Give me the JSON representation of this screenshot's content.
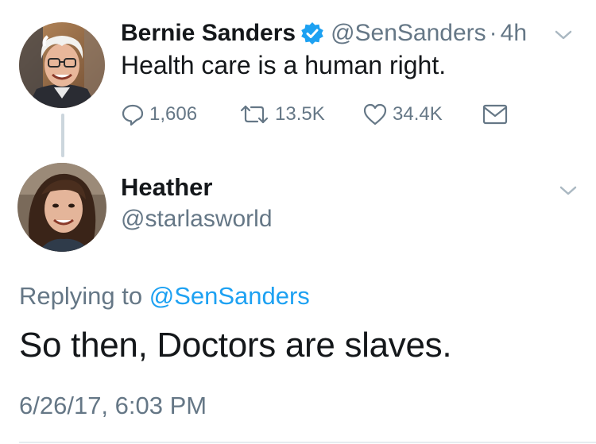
{
  "tweet": {
    "author_name": "Bernie Sanders",
    "author_handle": "@SenSanders",
    "separator": "·",
    "time_ago": "4h",
    "text": "Health care is a human right.",
    "stats": {
      "replies": "1,606",
      "retweets": "13.5K",
      "likes": "34.4K"
    },
    "verified_badge_icon": "verified-badge-icon",
    "badge_color": "#1da1f2"
  },
  "reply": {
    "author_name": "Heather",
    "author_handle": "@starlasworld",
    "replying_prefix": "Replying to",
    "replying_to": "@SenSanders",
    "text": "So then, Doctors are slaves.",
    "timestamp": "6/26/17, 6:03 PM"
  },
  "colors": {
    "text": "#14171a",
    "secondary": "#657786",
    "link": "#1da1f2",
    "thread_line": "#ccd6dd"
  }
}
